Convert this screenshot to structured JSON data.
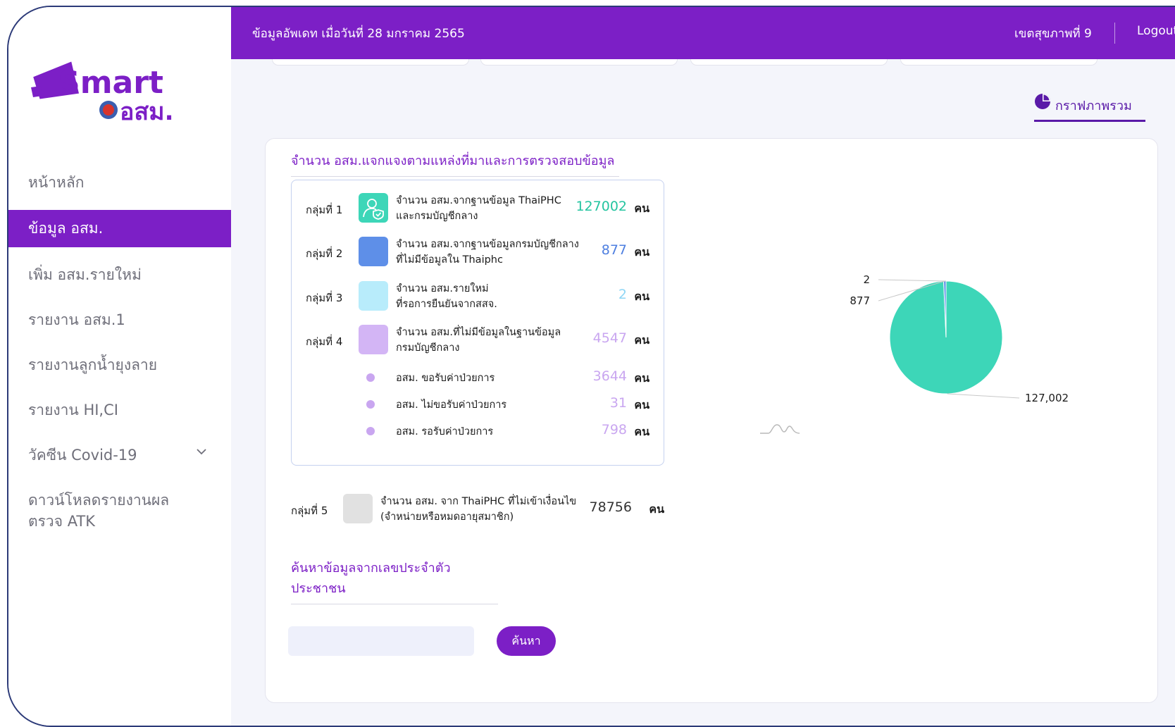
{
  "topbar": {
    "updated": "ข้อมูลอัพเดท เมื่อวันที่ 28 มกราคม 2565",
    "region": "เขตสุขภาพที่ 9",
    "logout": "Logout"
  },
  "logo": {
    "line1": "Smart",
    "line2": "อสม."
  },
  "sidebar": {
    "items": [
      {
        "label": "หน้าหลัก",
        "active": false
      },
      {
        "label": "ข้อมูล อสม.",
        "active": true
      },
      {
        "label": "เพิ่ม อสม.รายใหม่",
        "active": false
      },
      {
        "label": "รายงาน อสม.1",
        "active": false
      },
      {
        "label": "รายงานลูกน้ำยุงลาย",
        "active": false
      },
      {
        "label": "รายงาน HI,CI",
        "active": false
      },
      {
        "label": "วัคซีน Covid-19",
        "active": false
      },
      {
        "label": "ดาวน์โหลดรายงานผลตรวจ ATK",
        "active": false
      }
    ]
  },
  "tab": {
    "label": "กราฟภาพรวม",
    "icon": "pie-chart-icon"
  },
  "section": {
    "title": "จำนวน อสม.แจกแจงตามแหล่งที่มาและการตรวจสอบข้อมูล",
    "unit": "คน",
    "groups": [
      {
        "name": "กลุ่มที่ 1",
        "desc1": "จำนวน อสม.จากฐานข้อมูล ThaiPHC",
        "desc2": "และกรมบัญชีกลาง",
        "value": "127002",
        "color": "#24c4a0",
        "swatch": "#3dd6b8",
        "icon": "user-shield-icon"
      },
      {
        "name": "กลุ่มที่ 2",
        "desc1": "จำนวน อสม.จากฐานข้อมูลกรมบัญชีกลาง",
        "desc2": "ที่ไม่มีข้อมูลใน Thaiphc",
        "value": "877",
        "color": "#4e7fe0",
        "swatch": "#5e8fe8"
      },
      {
        "name": "กลุ่มที่ 3",
        "desc1": "จำนวน อสม.รายใหม่",
        "desc2": "ที่รอการยืนยันจากสสจ.",
        "value": "2",
        "color": "#8fd6f5",
        "swatch": "#b8ecfb"
      },
      {
        "name": "กลุ่มที่ 4",
        "desc1": "จำนวน อสม.ที่ไม่มีข้อมูลในฐานข้อมูล",
        "desc2": "กรมบัญชีกลาง",
        "value": "4547",
        "color": "#c9a6f0",
        "swatch": "#d3b5f5"
      }
    ],
    "subgroups": [
      {
        "label": "อสม. ขอรับค่าป่วยการ",
        "value": "3644"
      },
      {
        "label": "อสม. ไม่ขอรับค่าป่วยการ",
        "value": "31"
      },
      {
        "label": "อสม. รอรับค่าป่วยการ",
        "value": "798"
      }
    ],
    "group5": {
      "name": "กลุ่มที่ 5",
      "desc1": "จำนวน อสม. จาก ThaiPHC ที่ไม่เข้าเงื่อนไข",
      "desc2": "(จำหน่ายหรือหมดอายุสมาชิก)",
      "value": "78756"
    }
  },
  "search": {
    "title": "ค้นหาข้อมูลจากเลขประจำตัวประชาชน",
    "placeholder": "",
    "button": "ค้นหา"
  },
  "chart_data": {
    "type": "pie",
    "values": [
      127002,
      877,
      2
    ],
    "labels": [
      "127,002",
      "877",
      "2"
    ],
    "colors": [
      "#3dd6b8",
      "#5e8fe8",
      "#b8ecfb"
    ]
  }
}
